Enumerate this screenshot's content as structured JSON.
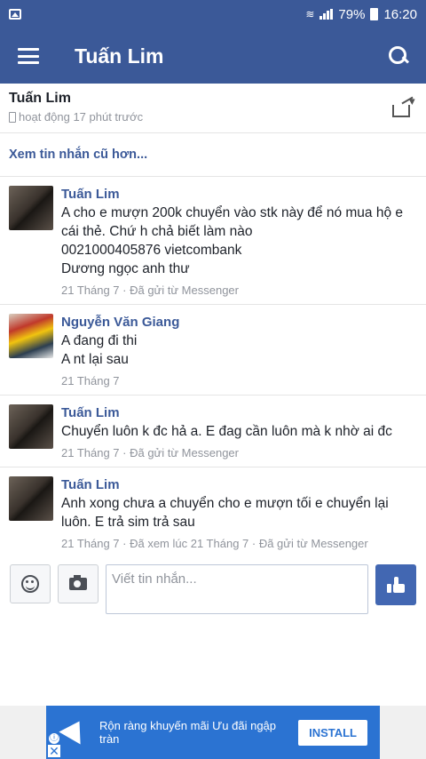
{
  "status_bar": {
    "battery": "79%",
    "time": "16:20"
  },
  "app_bar": {
    "title": "Tuấn Lim"
  },
  "thread": {
    "name": "Tuấn Lim",
    "status": "hoạt động 17 phút trước"
  },
  "older_messages_link": "Xem tin nhắn cũ hơn...",
  "messages": [
    {
      "sender": "Tuấn Lim",
      "lines": [
        "A cho e mượn 200k chuyển vào stk này để nó mua hộ e cái thẻ. Chứ h chả biết làm nào",
        "0021000405876 vietcombank",
        "Dương ngọc anh thư"
      ],
      "meta": "21 Tháng 7 · Đã gửi từ Messenger"
    },
    {
      "sender": "Nguyễn Văn Giang",
      "lines": [
        "A đang đi thi",
        "A nt lại sau"
      ],
      "meta": "21 Tháng 7"
    },
    {
      "sender": "Tuấn Lim",
      "lines": [
        "Chuyển luôn k đc hả a. E đag cần luôn mà k nhờ ai đc"
      ],
      "meta": "21 Tháng 7 · Đã gửi từ Messenger"
    },
    {
      "sender": "Tuấn Lim",
      "lines": [
        "Anh xong chưa a chuyển cho e mượn tối e chuyển lại luôn. E trả sim trả sau"
      ],
      "meta": "21 Tháng 7 · Đã xem lúc 21 Tháng 7 · Đã gửi từ Messenger"
    }
  ],
  "composer": {
    "placeholder": "Viết tin nhắn..."
  },
  "ad": {
    "text": "Rộn ràng khuyến mãi Ưu đãi ngập tràn",
    "install_label": "INSTALL",
    "info_glyph": "ⓘ",
    "close_glyph": "✕"
  },
  "colors": {
    "brand": "#3b5998",
    "like_button": "#4267b2",
    "ad_background": "#2b73d2"
  }
}
